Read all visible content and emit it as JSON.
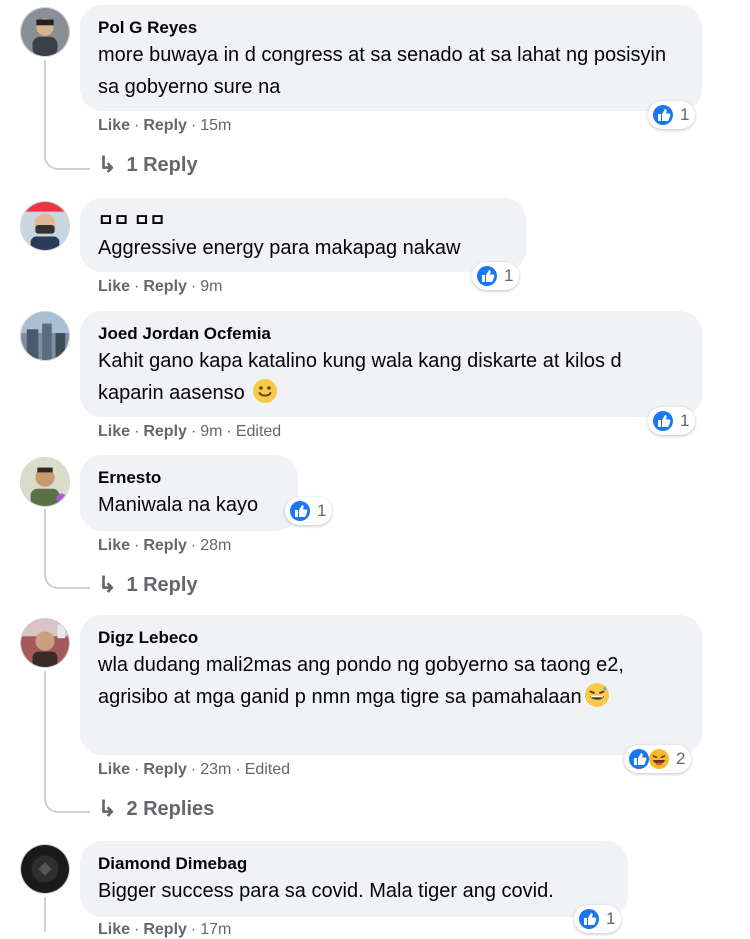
{
  "actions": {
    "like": "Like",
    "reply": "Reply",
    "dot": "·"
  },
  "colors": {
    "like_blue": "#1877f2",
    "haha_yellow": "#f7b928",
    "bubble": "#f0f2f5",
    "meta": "#65676b"
  },
  "comments": [
    {
      "author": "Pol G Reyes",
      "text": "more buwaya in d congress at sa senado at sa lahat ng posisyin sa gobyerno sure na",
      "time": "15m",
      "edited": "",
      "reactions": [
        "like-icon"
      ],
      "reaction_count": "1",
      "replies": "1 Reply"
    },
    {
      "author": "ㅁㅁ ㅁㅁ",
      "text": "Aggressive energy para makapag nakaw",
      "time": "9m",
      "edited": "",
      "reactions": [
        "like-icon"
      ],
      "reaction_count": "1",
      "replies": ""
    },
    {
      "author": "Joed Jordan Ocfemia",
      "text": "Kahit gano kapa katalino kung wala kang diskarte at kilos d kaparin aasenso",
      "emoji": "slightly-smiling-face",
      "time": "9m",
      "edited": "Edited",
      "reactions": [
        "like-icon"
      ],
      "reaction_count": "1",
      "replies": ""
    },
    {
      "author": "Ernesto",
      "text": "Maniwala na kayo",
      "time": "28m",
      "edited": "",
      "reactions": [
        "like-icon"
      ],
      "reaction_count": "1",
      "replies": "1 Reply"
    },
    {
      "author": "Digz Lebeco",
      "text": "wla dudang mali2mas ang pondo ng gobyerno sa taong e2, agrisibo at mga ganid p nmn mga tigre sa pamahalaan",
      "emoji": "grinning-sweat-face",
      "time": "23m",
      "edited": "Edited",
      "reactions": [
        "like-icon",
        "haha-icon"
      ],
      "reaction_count": "2",
      "replies": "2 Replies"
    },
    {
      "author": "Diamond Dimebag",
      "text": "Bigger success para sa covid. Mala tiger ang covid.",
      "time": "17m",
      "edited": "",
      "reactions": [
        "like-icon"
      ],
      "reaction_count": "1",
      "replies": ""
    }
  ]
}
